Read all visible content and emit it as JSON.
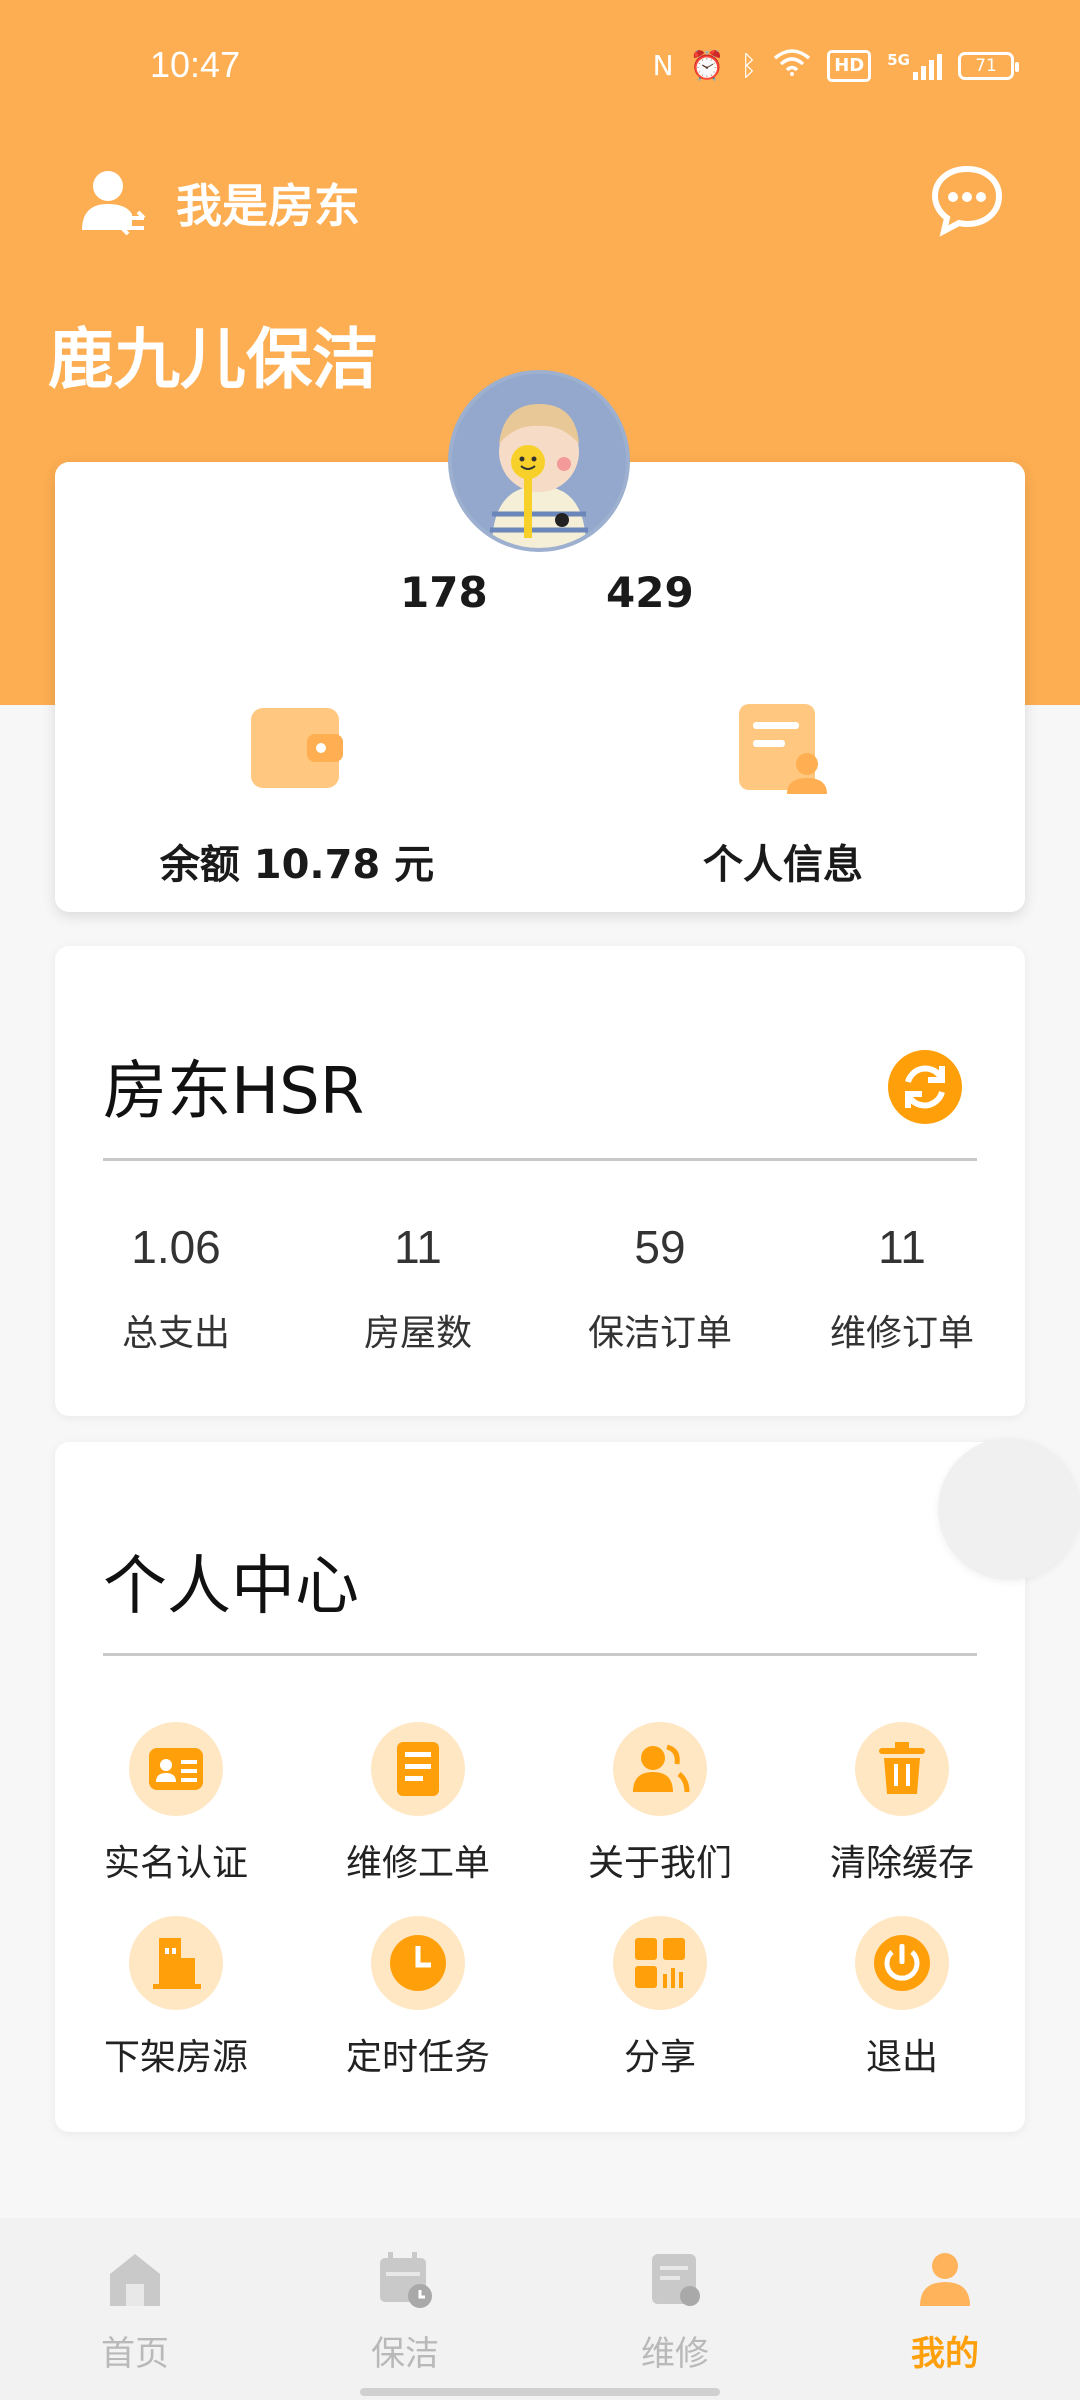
{
  "status_bar": {
    "time": "10:47",
    "icons": [
      "nfc-icon",
      "alarm-icon",
      "bluetooth-icon",
      "wifi-icon",
      "hd-icon",
      "signal-5g-icon",
      "battery-icon"
    ],
    "hd_label": "HD",
    "signal_label": "5G",
    "battery": "71"
  },
  "header": {
    "role_label": "我是房东",
    "app_title": "鹿九儿保洁"
  },
  "profile": {
    "stat_left": "178",
    "stat_right": "429",
    "balance_label": "余额 10.78 元",
    "info_label": "个人信息"
  },
  "landlord": {
    "title": "房东HSR",
    "stats": [
      {
        "value": "1.06",
        "label": "总支出"
      },
      {
        "value": "11",
        "label": "房屋数"
      },
      {
        "value": "59",
        "label": "保洁订单"
      },
      {
        "value": "11",
        "label": "维修订单"
      }
    ]
  },
  "center": {
    "title": "个人中心",
    "items": [
      {
        "label": "实名认证",
        "icon": "id-card-icon"
      },
      {
        "label": "维修工单",
        "icon": "work-order-icon"
      },
      {
        "label": "关于我们",
        "icon": "users-icon"
      },
      {
        "label": "清除缓存",
        "icon": "trash-icon"
      },
      {
        "label": "下架房源",
        "icon": "building-icon"
      },
      {
        "label": "定时任务",
        "icon": "clock-icon"
      },
      {
        "label": "分享",
        "icon": "qr-code-icon"
      },
      {
        "label": "退出",
        "icon": "power-icon"
      }
    ]
  },
  "nav": {
    "items": [
      {
        "label": "首页",
        "icon": "home-icon"
      },
      {
        "label": "保洁",
        "icon": "calendar-icon"
      },
      {
        "label": "维修",
        "icon": "document-icon"
      },
      {
        "label": "我的",
        "icon": "person-icon"
      }
    ],
    "active_color": "#FF9F0A"
  },
  "theme": {
    "accent": "#FDAE52",
    "accent_dark": "#FF9F0A"
  }
}
